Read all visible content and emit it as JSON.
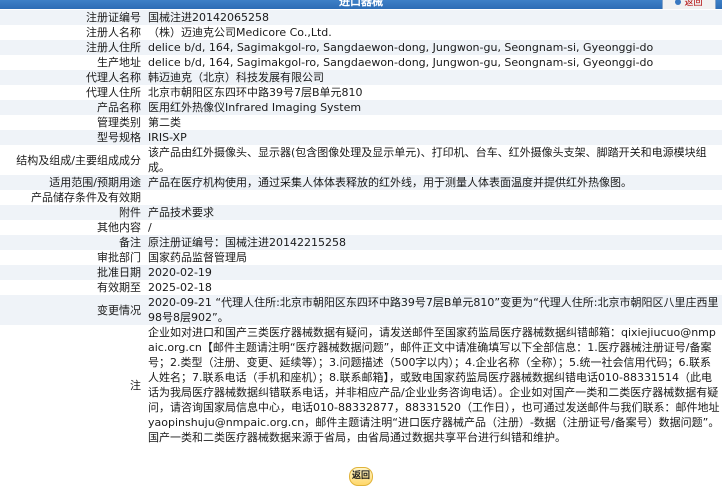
{
  "header": {
    "title": "进口器械",
    "back_top_label": "返回"
  },
  "rows": [
    {
      "label": "注册证编号",
      "value": "国械注进20142065258"
    },
    {
      "label": "注册人名称",
      "value": "（株）迈迪克公司Medicore Co.,Ltd."
    },
    {
      "label": "注册人住所",
      "value": "delice b/d, 164, Sagimakgol-ro, Sangdaewon-dong, Jungwon-gu, Seongnam-si, Gyeonggi-do"
    },
    {
      "label": "生产地址",
      "value": "delice b/d, 164, Sagimakgol-ro, Sangdaewon-dong, Jungwon-gu, Seongnam-si, Gyeonggi-do"
    },
    {
      "label": "代理人名称",
      "value": "韩迈迪克（北京）科技发展有限公司"
    },
    {
      "label": "代理人住所",
      "value": "北京市朝阳区东四环中路39号7层B单元810"
    },
    {
      "label": "产品名称",
      "value": "医用红外热像仪Infrared Imaging System"
    },
    {
      "label": "管理类别",
      "value": "第二类"
    },
    {
      "label": "型号规格",
      "value": "IRIS-XP"
    },
    {
      "label": "结构及组成/主要组成成分",
      "value": "该产品由红外摄像头、显示器(包含图像处理及显示单元)、打印机、台车、红外摄像头支架、脚踏开关和电源模块组成。"
    },
    {
      "label": "适用范围/预期用途",
      "value": "产品在医疗机构使用，通过采集人体体表释放的红外线，用于测量人体表面温度并提供红外热像图。"
    },
    {
      "label": "产品储存条件及有效期",
      "value": ""
    },
    {
      "label": "附件",
      "value": "产品技术要求"
    },
    {
      "label": "其他内容",
      "value": "/"
    },
    {
      "label": "备注",
      "value": "原注册证编号：国械注进20142215258"
    },
    {
      "label": "审批部门",
      "value": "国家药品监督管理局"
    },
    {
      "label": "批准日期",
      "value": "2020-02-19"
    },
    {
      "label": "有效期至",
      "value": "2025-02-18"
    },
    {
      "label": "变更情况",
      "value": "2020-09-21 “代理人住所:北京市朝阳区东四环中路39号7层B单元810”变更为“代理人住所:北京市朝阳区八里庄西里98号8层902”。"
    },
    {
      "label": "注",
      "value": "企业如对进口和国产三类医疗器械数据有疑问，请发送邮件至国家药监局医疗器械数据纠错邮箱：qixiejiucuo@nmpaic.org.cn【邮件主题请注明“医疗器械数据问题”，邮件正文中请准确填写以下全部信息：1.医疗器械注册证号/备案号；2.类型（注册、变更、延续等）；3.问题描述（500字以内）；4.企业名称（全称）；5.统一社会信用代码；6.联系人姓名；7.联系电话（手机和座机）；8.联系邮箱】，或致电国家药监局医疗器械数据纠错电话010-88331514（此电话为我局医疗器械数据纠错联系电话，并非相应产品/企业业务咨询电话）。企业如对国产一类和二类医疗器械数据有疑问，请咨询国家局信息中心，电话010-88332877，88331520（工作日），也可通过发送邮件与我们联系：邮件地址yaopinshuju@nmpaic.org.cn，邮件主题请注明“进口医疗器械产品（注册）-数据（注册证号/备案号）数据问题”。国产一类和二类医疗器械数据来源于省局，由省局通过数据共享平台进行纠错和维护。"
    }
  ],
  "footer": {
    "back_label": "返回"
  }
}
